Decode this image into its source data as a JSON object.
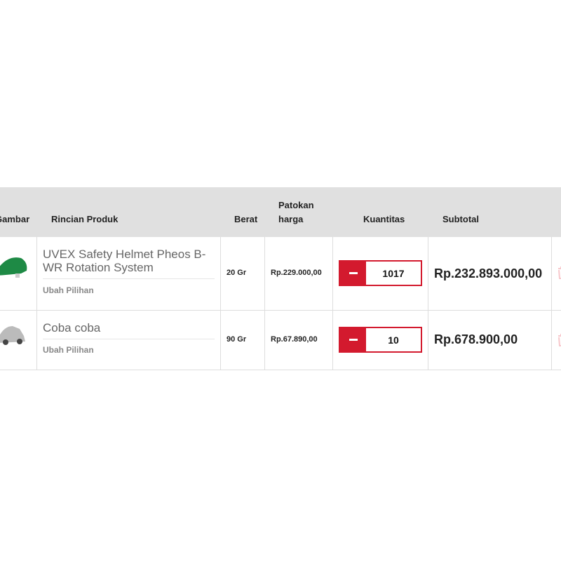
{
  "header": {
    "gambar": "Gambar",
    "rincian": "Rincian Produk",
    "berat": "Berat",
    "patokan": "Patokan harga",
    "kuantitas": "Kuantitas",
    "subtotal": "Subtotal"
  },
  "rows": [
    {
      "name": "UVEX Safety Helmet Pheos B-WR Rotation System",
      "ubah": "Ubah Pilihan",
      "berat": "20 Gr",
      "harga": "Rp.229.000,00",
      "qty": "1017",
      "subtotal": "Rp.232.893.000,00",
      "image": "green-helmet"
    },
    {
      "name": "Coba coba",
      "ubah": "Ubah Pilihan",
      "berat": "90 Gr",
      "harga": "Rp.67.890,00",
      "qty": "10",
      "subtotal": "Rp.678.900,00",
      "image": "silver-car"
    }
  ],
  "colors": {
    "accent": "#d31a2e",
    "header_bg": "#e0e0e0",
    "trash": "#f8c8cc"
  }
}
